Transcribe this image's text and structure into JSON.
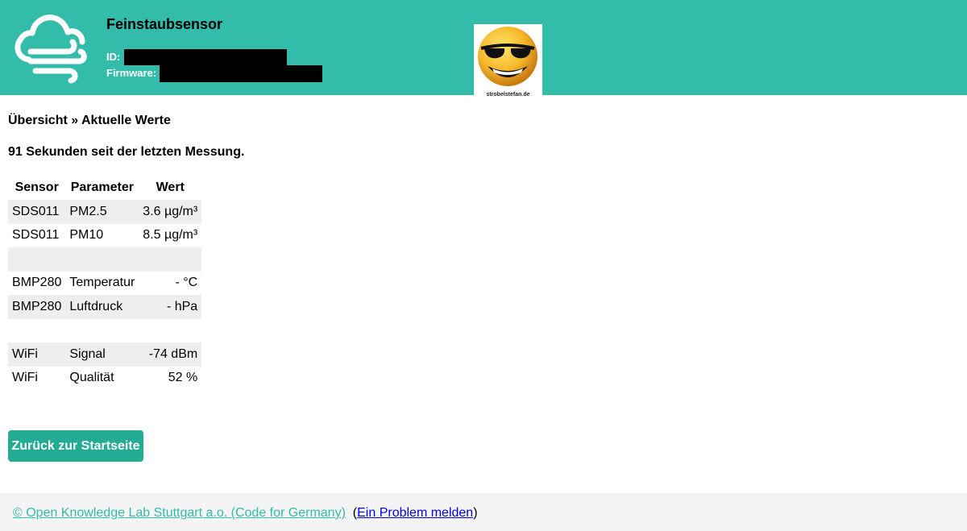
{
  "header": {
    "title": "Feinstaubsensor",
    "id_label": "ID:",
    "firmware_label": "Firmware:",
    "icon": "cloud-wind-icon",
    "sponsor_label": "strobelstefan.de",
    "sponsor_icon": "sunglasses-smiley-icon",
    "background_color": "#32bca9"
  },
  "breadcrumb": "Übersicht » Aktuelle Werte",
  "since_text": "91 Sekunden seit der letzten Messung.",
  "table": {
    "headers": [
      "Sensor",
      "Parameter",
      "Wert"
    ],
    "rows": [
      [
        "SDS011",
        "PM2.5",
        "3.6 µg/m³"
      ],
      [
        "SDS011",
        "PM10",
        "8.5 µg/m³"
      ],
      [
        "",
        "",
        ""
      ],
      [
        "BMP280",
        "Temperatur",
        "- °C"
      ],
      [
        "BMP280",
        "Luftdruck",
        "- hPa"
      ],
      [
        "",
        "",
        ""
      ],
      [
        "WiFi",
        "Signal",
        "-74 dBm"
      ],
      [
        "WiFi",
        "Qualität",
        "52 %"
      ]
    ]
  },
  "back_button": "Zurück zur Startseite",
  "footer": {
    "lab_link": "© Open Knowledge Lab Stuttgart a.o. (Code for Germany)",
    "open_paren": "(",
    "issue_link": "Ein Problem melden",
    "close_paren": ")"
  },
  "colors": {
    "accent": "#32bca9",
    "button": "#24ab94",
    "link": "#0000ee"
  }
}
